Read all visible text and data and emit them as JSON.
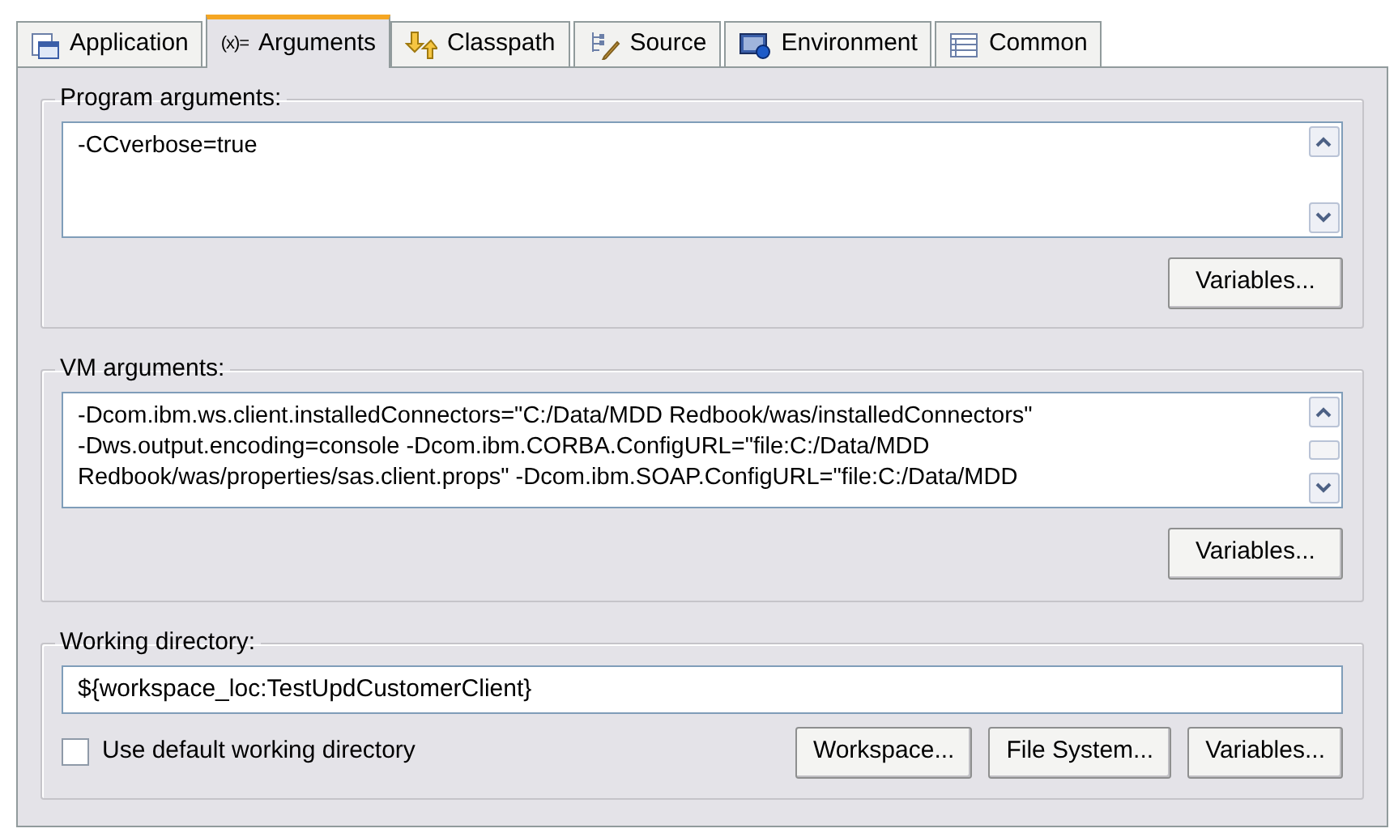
{
  "tabs": [
    {
      "label": "Application",
      "selected": false
    },
    {
      "label": "Arguments",
      "icon_text": "(x)=",
      "selected": true
    },
    {
      "label": "Classpath",
      "selected": false
    },
    {
      "label": "Source",
      "selected": false
    },
    {
      "label": "Environment",
      "selected": false
    },
    {
      "label": "Common",
      "selected": false
    }
  ],
  "program_arguments": {
    "title": "Program arguments:",
    "lines": [
      "-CCverbose=true"
    ],
    "button": "Variables..."
  },
  "vm_arguments": {
    "title": "VM arguments:",
    "lines": [
      "-Dcom.ibm.ws.client.installedConnectors=\"C:/Data/MDD Redbook/was/installedConnectors\"",
      "-Dws.output.encoding=console -Dcom.ibm.CORBA.ConfigURL=\"file:C:/Data/MDD",
      "Redbook/was/properties/sas.client.props\" -Dcom.ibm.SOAP.ConfigURL=\"file:C:/Data/MDD"
    ],
    "button": "Variables..."
  },
  "working_directory": {
    "title": "Working directory:",
    "value": "${workspace_loc:TestUpdCustomerClient}",
    "use_default": {
      "label": "Use default working directory",
      "checked": false
    },
    "buttons": [
      "Workspace...",
      "File System...",
      "Variables..."
    ]
  }
}
